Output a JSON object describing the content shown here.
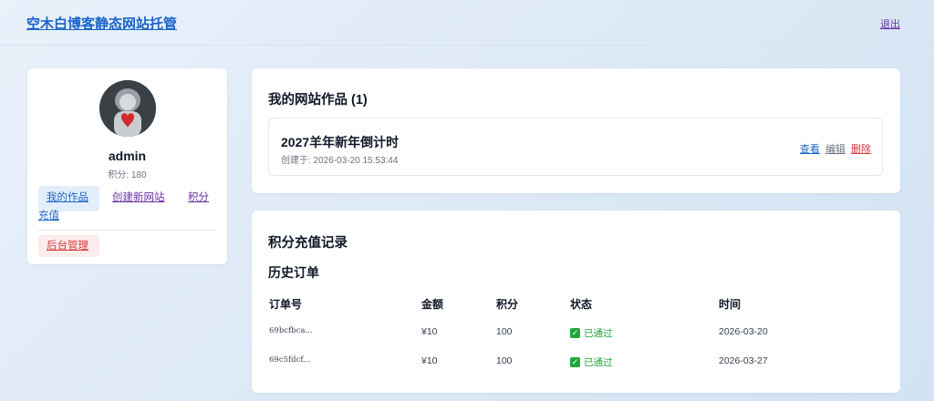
{
  "header": {
    "title": "空木白博客静态网站托管",
    "logout": "退出"
  },
  "profile": {
    "username": "admin",
    "points": "积分: 180",
    "nav": {
      "my_works": "我的作品",
      "create_site": "创建新网站",
      "recharge_part1": "积分",
      "recharge_part2": "充值",
      "admin": "后台管理"
    }
  },
  "works": {
    "title": "我的网站作品 (1)",
    "items": [
      {
        "name": "2027羊年新年倒计时",
        "created": "创建于: 2026-03-20 15:53:44",
        "actions": {
          "view": "查看",
          "edit": "编辑",
          "delete": "删除"
        }
      }
    ]
  },
  "recharge": {
    "title": "积分充值记录",
    "history_title": "历史订单",
    "columns": [
      "订单号",
      "金额",
      "积分",
      "状态",
      "时间"
    ],
    "rows": [
      {
        "order": "69bcfbca...",
        "amount": "¥10",
        "points": "100",
        "status": "已通过",
        "time": "2026-03-20"
      },
      {
        "order": "69c5fdcf...",
        "amount": "¥10",
        "points": "100",
        "status": "已通过",
        "time": "2026-03-27"
      }
    ]
  },
  "colors": {
    "accent": "#1a63c9",
    "visited": "#6b2fa0",
    "danger": "#d43b3b",
    "success": "#22a53a"
  }
}
